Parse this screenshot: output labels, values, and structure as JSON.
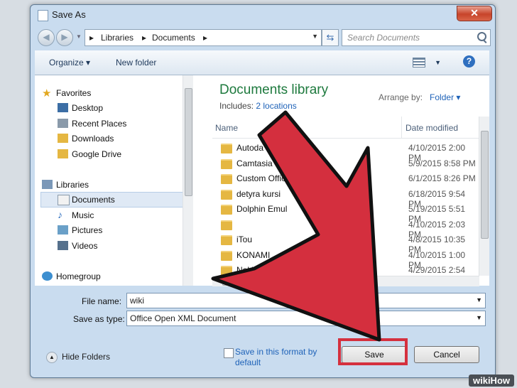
{
  "window": {
    "title": "Save As",
    "close_symbol": "✕"
  },
  "navigation": {
    "breadcrumbs": [
      "Libraries",
      "Documents"
    ],
    "search_placeholder": "Search Documents"
  },
  "toolbar": {
    "organize": "Organize ▾",
    "new_folder": "New folder",
    "help": "?"
  },
  "nav_pane": {
    "favorites_label": "Favorites",
    "favorites": [
      "Desktop",
      "Recent Places",
      "Downloads",
      "Google Drive"
    ],
    "libraries_label": "Libraries",
    "libraries": [
      "Documents",
      "Music",
      "Pictures",
      "Videos"
    ],
    "homegroup_label": "Homegroup"
  },
  "library": {
    "title": "Documents library",
    "includes_prefix": "Includes:",
    "includes_link": "2 locations",
    "arrange_by_label": "Arrange by:",
    "arrange_by_value": "Folder ▾"
  },
  "columns": {
    "name": "Name",
    "date_modified": "Date modified"
  },
  "files": [
    {
      "name": "Autoda",
      "date": "4/10/2015 2:00 PM"
    },
    {
      "name": "Camtasia",
      "date": "5/9/2015 8:58 PM"
    },
    {
      "name": "Custom Office Templates",
      "date": "6/1/2015 8:26 PM"
    },
    {
      "name": "detyra kursi",
      "date": "6/18/2015 9:54 PM"
    },
    {
      "name": "Dolphin Emul",
      "date": "5/19/2015 5:51 PM"
    },
    {
      "name": "",
      "date": "4/10/2015 2:03 PM"
    },
    {
      "name": "iTou",
      "date": "4/8/2015 10:35 PM"
    },
    {
      "name": "KONAMI",
      "date": "4/10/2015 1:00 PM"
    },
    {
      "name": "Nokia Suite",
      "date": "4/29/2015 2:54 PM"
    }
  ],
  "form": {
    "file_name_label": "File name:",
    "file_name_value": "wiki",
    "save_type_label": "Save as type:",
    "save_type_value": "Office Open XML Document"
  },
  "footer": {
    "hide_folders": "Hide Folders",
    "save_format_line1": "Save in this format by",
    "save_format_line2": "default",
    "save": "Save",
    "cancel": "Cancel"
  },
  "watermark": "wikiHow",
  "colors": {
    "arrow": "#d42f3e",
    "library_title": "#1e7a3e",
    "link": "#1e62b8"
  }
}
